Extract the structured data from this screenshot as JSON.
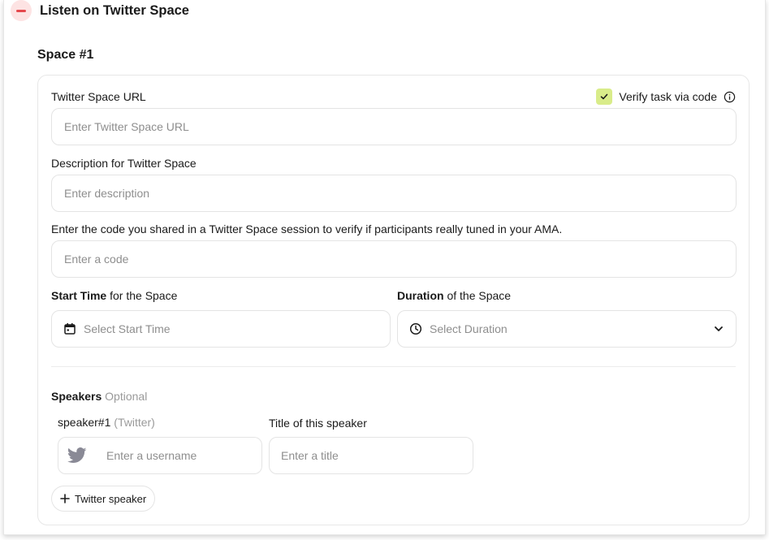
{
  "section": {
    "title": "Listen on Twitter Space"
  },
  "space": {
    "label": "Space #1",
    "url": {
      "label": "Twitter Space URL",
      "placeholder": "Enter Twitter Space URL",
      "value": ""
    },
    "verify": {
      "label": "Verify task via code",
      "checked": true
    },
    "description": {
      "label": "Description for Twitter Space",
      "placeholder": "Enter description",
      "value": ""
    },
    "code": {
      "label": "Enter the code you shared in a Twitter Space session to verify if participants really tuned in your AMA.",
      "placeholder": "Enter a code",
      "value": ""
    },
    "start": {
      "label_bold": "Start Time",
      "label_rest": " for the Space",
      "placeholder": "Select Start Time"
    },
    "duration": {
      "label_bold": "Duration",
      "label_rest": " of the Space",
      "placeholder": "Select Duration"
    },
    "speakers": {
      "label": "Speakers",
      "optional": "Optional",
      "items": [
        {
          "label": "speaker#1",
          "platform": "(Twitter)",
          "username_placeholder": "Enter a username",
          "title_label": "Title of this speaker",
          "title_placeholder": "Enter a title"
        }
      ],
      "add_label": "Twitter speaker"
    }
  },
  "colors": {
    "accent_red": "#e5484d",
    "check_green": "#d9ec8a",
    "twitter_icon": "#8a8a96"
  }
}
